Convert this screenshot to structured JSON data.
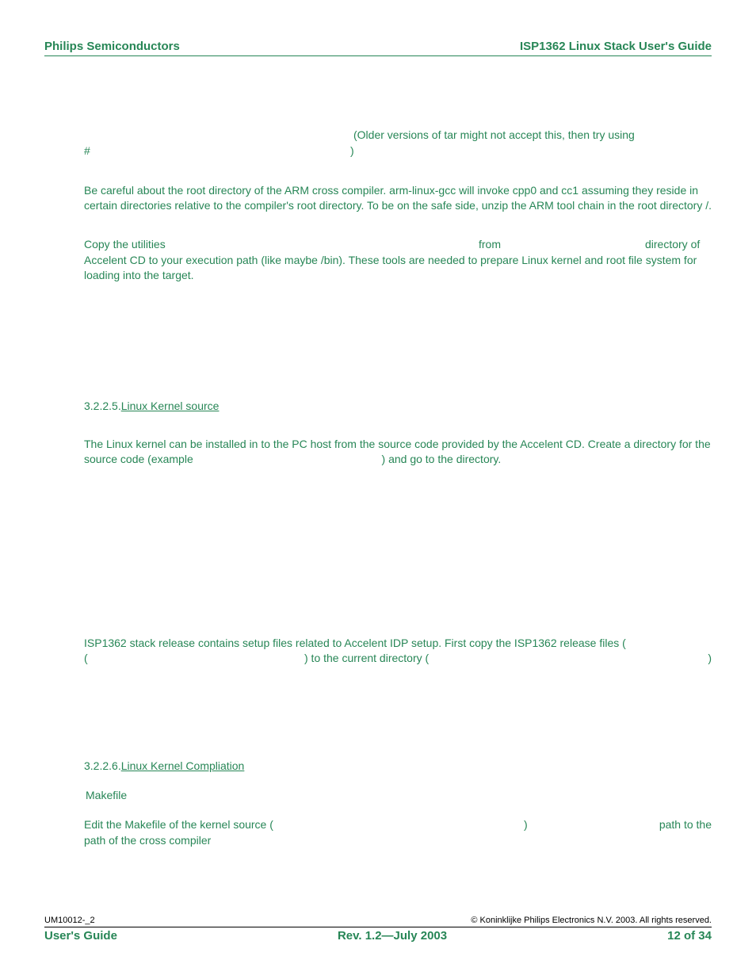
{
  "header": {
    "left": "Philips Semiconductors",
    "right": "ISP1362 Linux Stack User's Guide"
  },
  "body": {
    "tar_note": "(Older versions of tar might not accept this, then try using",
    "hash": "#",
    "close_paren": ")",
    "crosscompiler": "Be careful about the root directory of the ARM cross compiler. arm-linux-gcc will invoke cpp0 and cc1 assuming they reside in certain directories relative to the compiler's root directory. To be on the safe side, unzip the ARM tool chain in the root directory /.",
    "copy_pre": "Copy the utilities",
    "copy_mid1": "from",
    "copy_mid2": "directory of",
    "copy_rest": "Accelent CD to your execution path (like maybe /bin).  These tools are needed to prepare Linux kernel and root file system for loading into the target.",
    "sec5_num": "3.2.2.5.",
    "sec5_title": "Linux Kernel source",
    "kernel_para": "The Linux kernel can be installed in to the PC host from the source code provided by the Accelent CD. Create a directory for the source code (example",
    "kernel_para_tail": ") and go to the directory.",
    "isp_para": "ISP1362 stack release contains setup files related to Accelent IDP setup. First copy the ISP1362 release files (",
    "isp_mid": ") to the current directory (",
    "isp_tail": ")",
    "sec6_num": "3.2.2.6.",
    "sec6_title": "Linux Kernel Compliation",
    "makefile": "Makefile",
    "edit_pre": "Edit  the  Makefile  of  the  kernel  source  (",
    "edit_close": ")",
    "edit_tail1": "path  to  the",
    "edit_tail2": "path of the cross compiler"
  },
  "footer": {
    "docnum": "UM10012-_2",
    "copyright": "© Koninklijke Philips Electronics N.V. 2003. All rights reserved.",
    "left": "User's Guide",
    "center": "Rev. 1.2—July 2003",
    "right": "12 of 34"
  }
}
